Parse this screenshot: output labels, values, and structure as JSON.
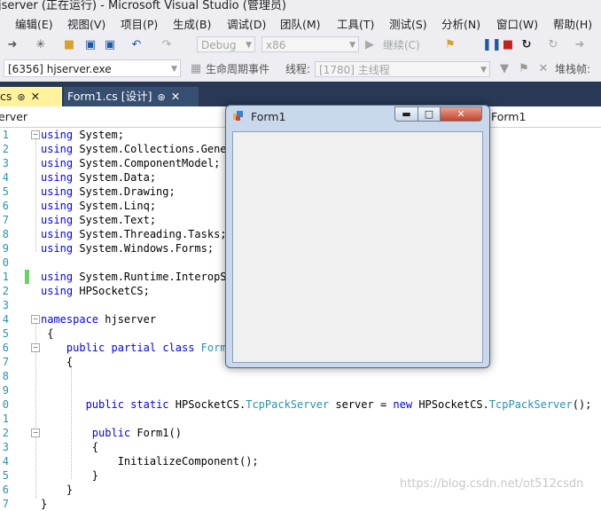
{
  "window": {
    "title": "jserver (正在运行) - Microsoft Visual Studio (管理员)"
  },
  "menu": [
    "编辑(E)",
    "视图(V)",
    "项目(P)",
    "生成(B)",
    "调试(D)",
    "团队(M)",
    "工具(T)",
    "测试(S)",
    "分析(N)",
    "窗口(W)",
    "帮助(H)"
  ],
  "toolbar": {
    "config_value": "Debug",
    "platform_value": "x86",
    "continue_label": "继续(C)"
  },
  "debug_toolbar": {
    "process_value": "[6356] hjserver.exe",
    "lifecycle_label": "生命周期事件",
    "thread_label": "线程:",
    "thread_value": "[1780] 主线程",
    "stackframe_label": "堆栈帧:"
  },
  "tabs": [
    {
      "label": "cs"
    },
    {
      "label": "Form1.cs [设计]"
    }
  ],
  "navbar": {
    "left": "erver",
    "right": "Form1"
  },
  "form_window": {
    "title": "Form1"
  },
  "code": {
    "line_numbers": [
      "1",
      "2",
      "3",
      "4",
      "5",
      "6",
      "7",
      "8",
      "9",
      "0",
      "1",
      "2",
      "3",
      "4",
      "5",
      "6",
      "7",
      "8",
      "9",
      "0",
      "1",
      "2",
      "3",
      "4",
      "5",
      "6",
      "7"
    ],
    "lines": [
      [
        {
          "t": "using",
          "c": "kw"
        },
        {
          "t": " System;"
        }
      ],
      [
        {
          "t": "using",
          "c": "kw"
        },
        {
          "t": " System.Collections.Gener"
        }
      ],
      [
        {
          "t": "using",
          "c": "kw"
        },
        {
          "t": " System.ComponentModel;"
        }
      ],
      [
        {
          "t": "using",
          "c": "kw"
        },
        {
          "t": " System.Data;"
        }
      ],
      [
        {
          "t": "using",
          "c": "kw"
        },
        {
          "t": " System.Drawing;"
        }
      ],
      [
        {
          "t": "using",
          "c": "kw"
        },
        {
          "t": " System.Linq;"
        }
      ],
      [
        {
          "t": "using",
          "c": "kw"
        },
        {
          "t": " System.Text;"
        }
      ],
      [
        {
          "t": "using",
          "c": "kw"
        },
        {
          "t": " System.Threading.Tasks;"
        }
      ],
      [
        {
          "t": "using",
          "c": "kw"
        },
        {
          "t": " System.Windows.Forms;"
        }
      ],
      [],
      [
        {
          "t": "using",
          "c": "kw"
        },
        {
          "t": " System.Runtime.InteropSe"
        }
      ],
      [
        {
          "t": "using",
          "c": "kw"
        },
        {
          "t": " HPSocketCS;"
        }
      ],
      [],
      [
        {
          "t": "namespace",
          "c": "kw"
        },
        {
          "t": " hjserver"
        }
      ],
      [
        {
          "t": " {"
        }
      ],
      [
        {
          "t": "    "
        },
        {
          "t": "public",
          "c": "kw"
        },
        {
          "t": " "
        },
        {
          "t": "partial",
          "c": "kw"
        },
        {
          "t": " "
        },
        {
          "t": "class",
          "c": "kw"
        },
        {
          "t": " "
        },
        {
          "t": "Form1",
          "c": "ty"
        }
      ],
      [
        {
          "t": "    {"
        }
      ],
      [],
      [],
      [
        {
          "t": "       "
        },
        {
          "t": "public",
          "c": "kw"
        },
        {
          "t": " "
        },
        {
          "t": "static",
          "c": "kw"
        },
        {
          "t": " HPSocketCS."
        },
        {
          "t": "TcpPackServer",
          "c": "ty"
        },
        {
          "t": " server = "
        },
        {
          "t": "new",
          "c": "kw"
        },
        {
          "t": " HPSocketCS."
        },
        {
          "t": "TcpPackServer",
          "c": "ty"
        },
        {
          "t": "();"
        }
      ],
      [],
      [
        {
          "t": "        "
        },
        {
          "t": "public",
          "c": "kw"
        },
        {
          "t": " Form1()"
        }
      ],
      [
        {
          "t": "        {"
        }
      ],
      [
        {
          "t": "            InitializeComponent();"
        }
      ],
      [
        {
          "t": "        }"
        }
      ],
      [
        {
          "t": "    }"
        }
      ],
      [
        {
          "t": "}"
        }
      ]
    ]
  },
  "watermark": "https://blog.csdn.net/ot512csdn",
  "colors": {
    "keyword": "#0000ff",
    "type": "#2b91af",
    "linenumber": "#2b91af",
    "tab_active": "#fff29d",
    "tabstrip": "#293955"
  }
}
